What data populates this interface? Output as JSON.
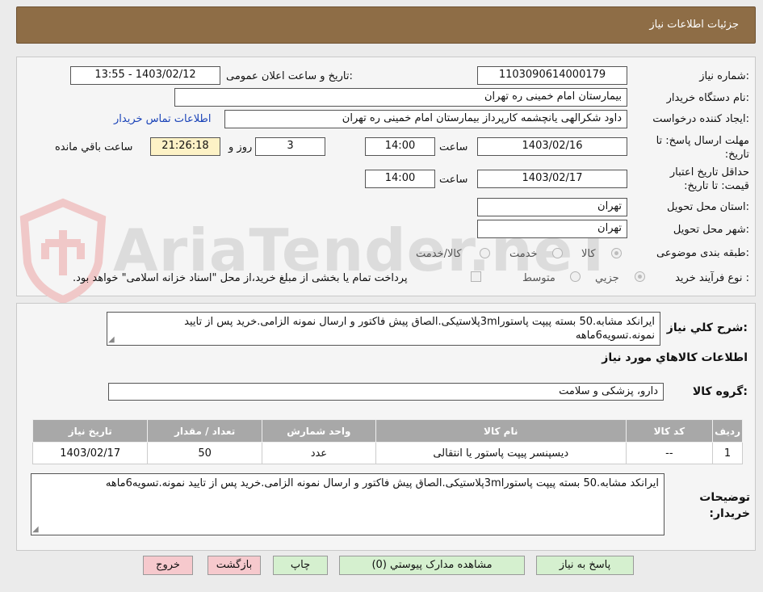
{
  "header": {
    "title": "جزئیات اطلاعات نیاز"
  },
  "watermark": {
    "text": "AriaTender.neT"
  },
  "form": {
    "need_number_label": "شماره نیاز:",
    "need_number": "1103090614000179",
    "announce_label": "تاریخ و ساعت اعلان عمومی:",
    "announce_value": "1403/02/12 - 13:55",
    "buyer_org_label": "نام دستگاه خریدار:",
    "buyer_org": "بیمارستان امام خمینی ره  تهران",
    "requester_label": "ایجاد کننده درخواست:",
    "requester": "داود شکرالهی یانچشمه کارپرداز بیمارستان امام خمینی ره  تهران",
    "contact_link": "اطلاعات تماس خریدار",
    "deadline_label": "مهلت ارسال پاسخ: تا تاریخ:",
    "deadline_date": "1403/02/16",
    "time_label": "ساعت",
    "deadline_time": "14:00",
    "days_value": "3",
    "days_label": "روز و",
    "remaining_time": "21:26:18",
    "remaining_label": "ساعت باقي مانده",
    "validity_label": "حداقل تاریخ اعتبار قیمت: تا تاریخ:",
    "validity_date": "1403/02/17",
    "validity_time": "14:00",
    "province_label": "استان محل تحویل:",
    "province": "تهران",
    "city_label": "شهر محل تحویل:",
    "city": "تهران",
    "category_label": "طبقه بندی موضوعی:",
    "category_options": [
      "کالا",
      "خدمت",
      "کالا/خدمت"
    ],
    "category_selected": "کالا",
    "process_label": "نوع فرآیند خرید :",
    "process_options": [
      "جزیي",
      "متوسط"
    ],
    "process_selected": "جزیي",
    "treasury_note": "پرداخت تمام یا بخشی از مبلغ خرید،از محل \"اسناد خزانه اسلامی\" خواهد بود."
  },
  "summary": {
    "general_desc_label": "شرح کلي نياز:",
    "general_desc": "ایرانکد مشابه.50 بسته پیپت پاستور3mlپلاستیکی.الصاق پیش فاکتور و ارسال نمونه الزامی.خرید پس از تایید نمونه.تسویه6ماهه",
    "goods_info_title": "اطلاعات کالاهاي مورد نياز",
    "goods_group_label": "گروه کالا:",
    "goods_group": "دارو، پزشکی و سلامت"
  },
  "table": {
    "headers": [
      "ردیف",
      "کد کالا",
      "نام کالا",
      "واحد شمارش",
      "تعداد / مقدار",
      "تاریخ نیاز"
    ],
    "rows": [
      [
        "1",
        "--",
        "دیسپنسر پیپت پاستور یا انتقالی",
        "عدد",
        "50",
        "1403/02/17"
      ]
    ]
  },
  "buyer_notes": {
    "label": "توضیحات خریدار:",
    "text": "ایرانکد مشابه.50 بسته پیپت پاستور3mlپلاستیکی.الصاق پیش فاکتور و ارسال نمونه الزامی.خرید پس از تایید نمونه.تسویه6ماهه"
  },
  "buttons": {
    "reply": "پاسخ به نیاز",
    "attachments": "مشاهده مدارک پیوستي (0)",
    "print": "چاپ",
    "back": "بازگشت",
    "exit": "خروج"
  },
  "colors": {
    "header_bg": "#8e6d46",
    "link": "#1a43b8",
    "green_button": "#d5f0cf",
    "pink_button": "#f6c9cd",
    "table_header": "#a8a8a8"
  }
}
